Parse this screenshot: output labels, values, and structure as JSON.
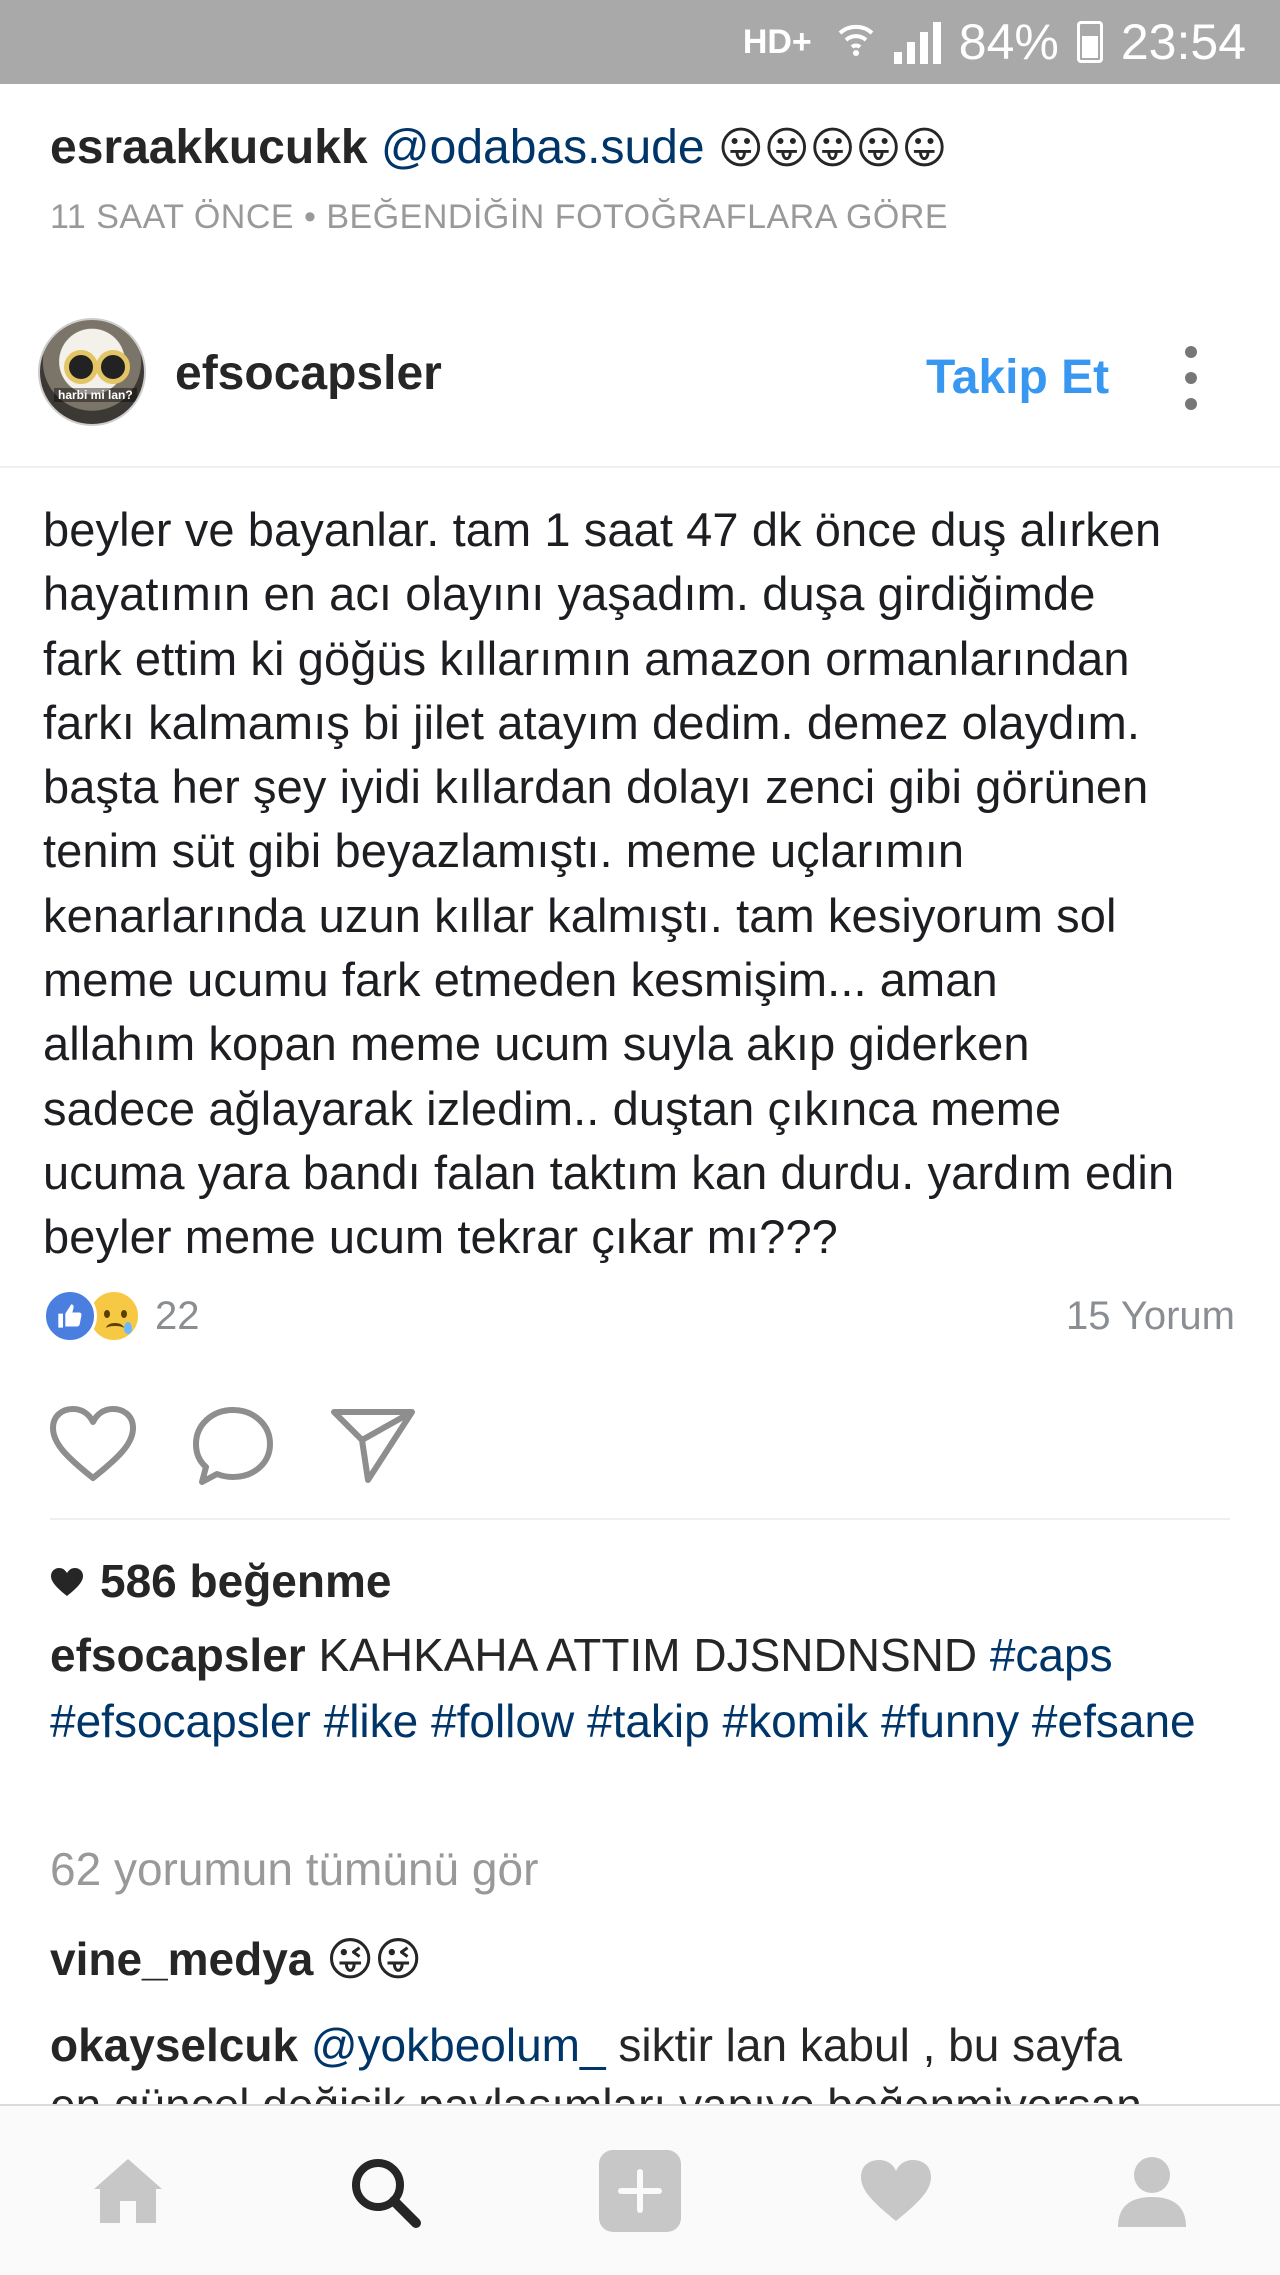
{
  "status_bar": {
    "network": "HD+",
    "battery_percent": "84%",
    "time": "23:54"
  },
  "notification": {
    "user": "esraakkucukk",
    "mention": "@odabas.sude",
    "emojis": "😛😛😛😛😛",
    "meta": "11 SAAT ÖNCE • BEĞENDİĞİN FOTOĞRAFLARA GÖRE"
  },
  "post": {
    "username": "efsocapsler",
    "avatar_caption": "harbi mi lan?",
    "follow_label": "Takip Et",
    "text": "beyler ve bayanlar. tam 1 saat 47 dk önce duş alırken\nhayatımın en acı olayını yaşadım. duşa girdiğimde\nfark ettim ki göğüs kıllarımın amazon ormanlarından\nfarkı kalmamış bi jilet atayım dedim. demez olaydım.\nbaşta her şey iyidi kıllardan dolayı zenci gibi görünen\ntenim süt gibi beyazlamıştı. meme uçlarımın\nkenarlarında uzun kıllar kalmıştı. tam kesiyorum sol\nmeme ucumu fark etmeden kesmişim...  aman\nallahım kopan meme ucum suyla akıp giderken\nsadece ağlayarak izledim.. duştan çıkınca meme\nucuma yara bandı falan taktım kan durdu. yardım edin\nbeyler meme ucum tekrar çıkar mı???",
    "reaction_count": "22",
    "comment_count_label": "15 Yorum",
    "likes_label": "586 beğenme",
    "caption_user": "efsocapsler",
    "caption_text": "KAHKAHA ATTIM DJSNDNSND",
    "caption_tags": [
      "#caps",
      "#efsocapsler",
      "#like",
      "#follow",
      "#takip",
      "#komik",
      "#funny",
      "#efsane"
    ],
    "view_all_comments": "62 yorumun tümünü gör",
    "comments": [
      {
        "user": "vine_medya",
        "text": "😜😜"
      },
      {
        "user": "okayselcuk",
        "mention": "@yokbeolum_",
        "text": "siktir lan kabul , bu sayfa",
        "continuation": "en güncel değişik paylaşımları yapıyo beğenmiyorsan"
      }
    ]
  },
  "colors": {
    "status_bar_bg": "#a9a9a9",
    "follow_blue": "#3897f0",
    "hashtag_blue": "#003569",
    "muted_gray": "#999999"
  },
  "icons": {
    "actions": [
      "heart-icon",
      "comment-icon",
      "share-icon"
    ],
    "nav": [
      "home-icon",
      "search-icon",
      "add-icon",
      "heart-icon",
      "profile-icon"
    ]
  }
}
